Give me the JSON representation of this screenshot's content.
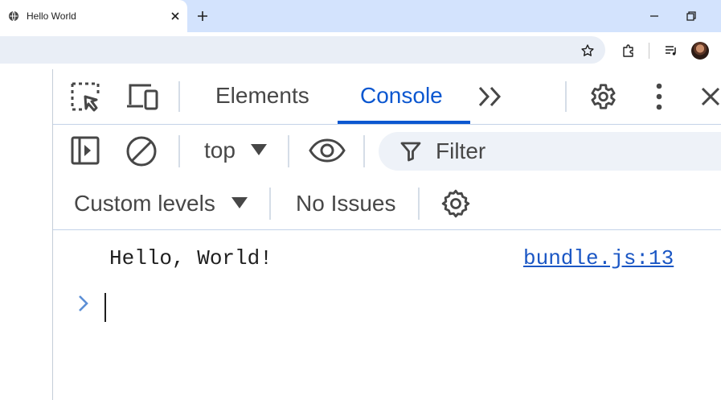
{
  "browser": {
    "tab": {
      "title": "Hello World"
    },
    "toolbar": {}
  },
  "devtools": {
    "tabs": [
      {
        "label": "Elements",
        "active": false
      },
      {
        "label": "Console",
        "active": true
      }
    ],
    "console_toolbar": {
      "context": "top",
      "filter_placeholder": "Filter",
      "levels": "Custom levels",
      "issues": "No Issues"
    },
    "messages": [
      {
        "text": "Hello, World!",
        "source": "bundle.js:13"
      }
    ]
  },
  "colors": {
    "accent": "#0b57d0",
    "link": "#1a56c4",
    "tabstrip": "#d3e3fd",
    "omnibox": "#e9eef6"
  },
  "icons": [
    "globe-icon",
    "close-icon",
    "plus-icon",
    "minimize-icon",
    "restore-icon",
    "star-icon",
    "extensions-icon",
    "media-icon",
    "avatar",
    "inspect-icon",
    "device-icon",
    "more-tabs-icon",
    "settings-icon",
    "kebab-icon",
    "sidebar-toggle-icon",
    "clear-icon",
    "dropdown-arrow-icon",
    "eye-icon",
    "filter-icon",
    "prompt-chevron-icon"
  ]
}
